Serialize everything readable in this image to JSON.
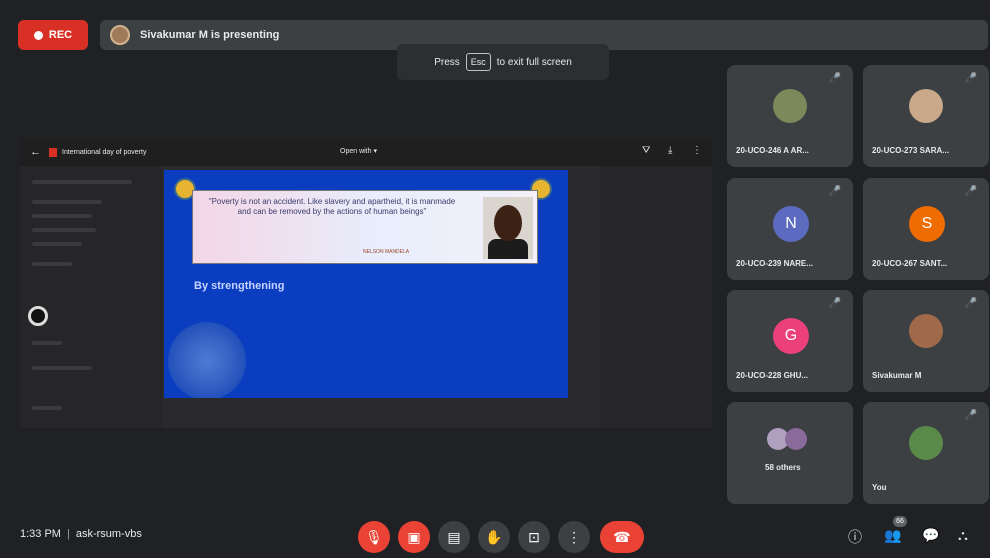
{
  "topbar": {
    "rec_label": "REC",
    "presenting_text": "Sivakumar M is presenting"
  },
  "fullscreen_banner": {
    "press": "Press",
    "key": "Esc",
    "suffix": "to exit full screen"
  },
  "viewer": {
    "doc_title": "International day of poverty",
    "open_with": "Open with ▾"
  },
  "slide": {
    "quote": "\"Poverty is not an accident. Like slavery and apartheid, it is manmade and can be removed by the actions of human beings\"",
    "author": "NELSON MANDELA",
    "subtitle": "By strengthening"
  },
  "participants": [
    {
      "name": "20-UCO-246 A AR...",
      "type": "photo"
    },
    {
      "name": "20-UCO-273 SARA...",
      "type": "photo"
    },
    {
      "name": "20-UCO-239 NARE...",
      "type": "letter",
      "letter": "N",
      "color": "#5c6bc0"
    },
    {
      "name": "20-UCO-267 SANT...",
      "type": "letter",
      "letter": "S",
      "color": "#ef6c00"
    },
    {
      "name": "20-UCO-228 GHU...",
      "type": "letter",
      "letter": "G",
      "color": "#ec407a"
    },
    {
      "name": "Sivakumar M",
      "type": "photo"
    },
    {
      "name": "58 others",
      "type": "group"
    },
    {
      "name": "You",
      "type": "photo"
    }
  ],
  "footer": {
    "time": "1:33 PM",
    "meeting_code": "ask-rsum-vbs",
    "participant_badge": "66"
  },
  "colors": {
    "background": "#202124",
    "tile": "#3c4043",
    "danger": "#ea4335",
    "slide": "#0a3dbf"
  }
}
